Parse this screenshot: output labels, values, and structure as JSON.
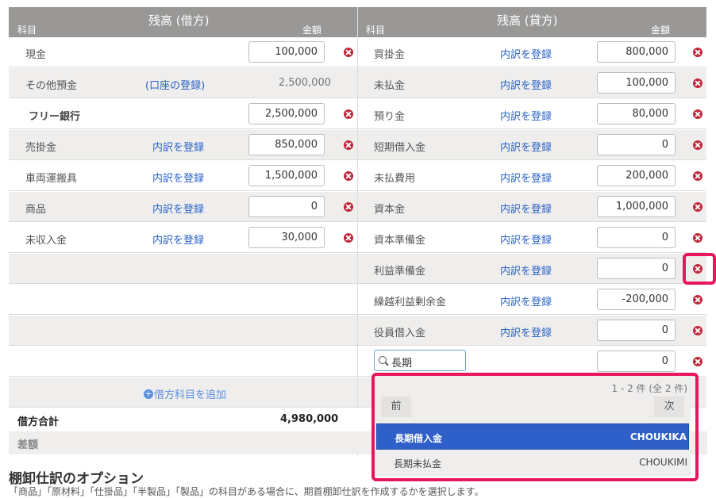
{
  "debit": {
    "header_title": "残高 (借方)",
    "col_subject": "科目",
    "col_amount": "金額",
    "rows": [
      {
        "subject": "現金",
        "link": "",
        "amount": "100,000"
      },
      {
        "subject": "その他預金",
        "link": "(口座の登録)",
        "amount": "2,500,000"
      },
      {
        "subject": "フリー銀行",
        "link": "",
        "amount": "2,500,000"
      },
      {
        "subject": "売掛金",
        "link": "内訳を登録",
        "amount": "850,000"
      },
      {
        "subject": "車両運搬具",
        "link": "内訳を登録",
        "amount": "1,500,000"
      },
      {
        "subject": "商品",
        "link": "内訳を登録",
        "amount": "0"
      },
      {
        "subject": "未収入金",
        "link": "内訳を登録",
        "amount": "30,000"
      }
    ],
    "add_label": "借方科目を追加",
    "total_label": "借方合計",
    "total_value": "4,980,000",
    "diff_label": "差額"
  },
  "credit": {
    "header_title": "残高 (貸方)",
    "col_subject": "科目",
    "col_amount": "金額",
    "rows": [
      {
        "subject": "買掛金",
        "link": "内訳を登録",
        "amount": "800,000"
      },
      {
        "subject": "未払金",
        "link": "内訳を登録",
        "amount": "100,000"
      },
      {
        "subject": "預り金",
        "link": "内訳を登録",
        "amount": "80,000"
      },
      {
        "subject": "短期借入金",
        "link": "内訳を登録",
        "amount": "0"
      },
      {
        "subject": "未払費用",
        "link": "内訳を登録",
        "amount": "200,000"
      },
      {
        "subject": "資本金",
        "link": "内訳を登録",
        "amount": "1,000,000"
      },
      {
        "subject": "資本準備金",
        "link": "内訳を登録",
        "amount": "0"
      },
      {
        "subject": "利益準備金",
        "link": "内訳を登録",
        "amount": "0"
      },
      {
        "subject": "繰越利益剰余金",
        "link": "内訳を登録",
        "amount": "-200,000"
      },
      {
        "subject": "役員借入金",
        "link": "内訳を登録",
        "amount": "0"
      }
    ],
    "search_value": "長期",
    "search_amount": "0"
  },
  "dropdown": {
    "count": "1 - 2 件 (全 2 件)",
    "prev": "前",
    "next": "次",
    "options": [
      {
        "name": "長期借入金",
        "code": "CHOUKIKA"
      },
      {
        "name": "長期未払金",
        "code": "CHOUKIMI"
      }
    ]
  },
  "options": {
    "title": "棚卸仕訳のオプション",
    "description": "「商品」「原材料」「仕掛品」「半製品」「製品」の科目がある場合に、期首棚卸仕訳を作成するかを選択します。"
  },
  "colors": {
    "header": "#9a9896",
    "link": "#2a63c8",
    "delete": "#c0273a",
    "highlight": "#e8175d",
    "selected": "#2f5fc8"
  }
}
